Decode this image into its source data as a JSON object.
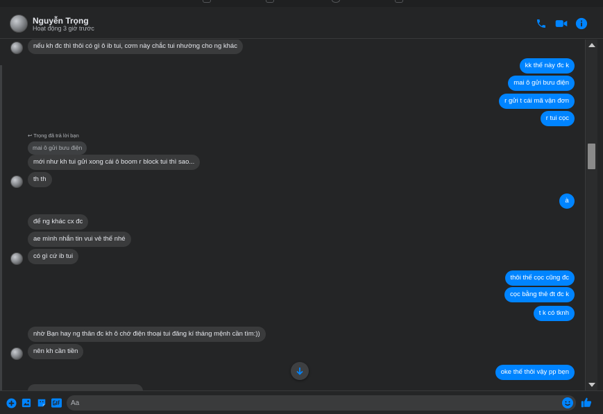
{
  "header": {
    "name": "Nguyễn Trọng",
    "status": "Hoạt động 3 giờ trước",
    "icons": [
      "phone-icon",
      "video-camera-icon",
      "info-icon"
    ]
  },
  "messages": [
    {
      "id": "m1",
      "side": "in",
      "text": "nếu kh đc thì thôi có gì ô ib tui, cơm này chắc tui nhường cho ng khác"
    },
    {
      "id": "m2",
      "side": "out",
      "text": "kk thế này đc k"
    },
    {
      "id": "m3",
      "side": "out",
      "text": "mai ô gửi bưu điện"
    },
    {
      "id": "m4",
      "side": "out",
      "text": "r gửi t cái mã vận đơn"
    },
    {
      "id": "m5",
      "side": "out",
      "text": "r tui cọc"
    },
    {
      "id": "m6",
      "side": "in",
      "reply_note": "Trọng đã trả lời bạn",
      "replied_text": "mai ô gửi bưu điện",
      "text": "mới như kh tui gửi xong cái ô boom r block tui thì sao..."
    },
    {
      "id": "m7",
      "side": "in",
      "text": "th th"
    },
    {
      "id": "m8",
      "side": "out",
      "text": "à"
    },
    {
      "id": "m9",
      "side": "in",
      "text": "để ng khác cx đc"
    },
    {
      "id": "m10",
      "side": "in",
      "text": "ae mình nhắn tin vui vẻ thế nhé"
    },
    {
      "id": "m11",
      "side": "in",
      "text": "có gì cứ ib tui"
    },
    {
      "id": "m12",
      "side": "out",
      "text": "thôi thế cọc cũng đc"
    },
    {
      "id": "m13",
      "side": "out",
      "text": "cọc bằng thẻ đt đc k"
    },
    {
      "id": "m14",
      "side": "out",
      "text": "t k có tknh"
    },
    {
      "id": "m15",
      "side": "in",
      "text": "nhờ Bạn hay ng thân đc kh ô chớ điện thoại tui đăng kí tháng mệnh cần tìm:))"
    },
    {
      "id": "m16",
      "side": "in",
      "text": "nên kh cần tiền"
    },
    {
      "id": "m17",
      "side": "out",
      "text": "oke thế thôi vậy pp bẹn"
    }
  ],
  "composer": {
    "placeholder": "Aa",
    "icons": [
      "plus-circle-icon",
      "image-icon",
      "sticker-icon",
      "gif-icon",
      "emoji-icon",
      "thumbs-up-icon"
    ]
  },
  "colors": {
    "background": "#242526",
    "incoming_bubble": "#3a3b3c",
    "outgoing_bubble": "#0084ff",
    "accent": "#0084ff",
    "text": "#e4e6eb",
    "secondary_text": "#b0b3b8"
  }
}
